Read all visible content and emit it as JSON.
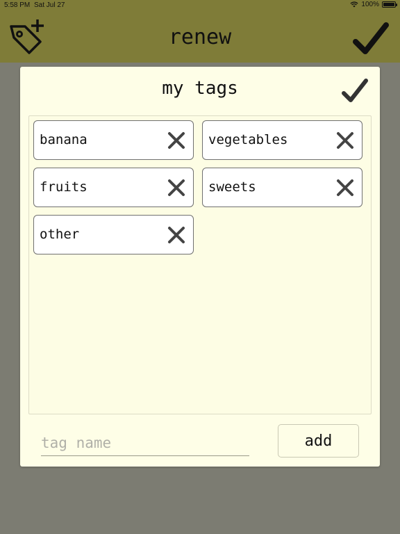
{
  "status_bar": {
    "time": "5:58 PM",
    "date": "Sat Jul 27",
    "battery": "100%",
    "battery_level": 1.0
  },
  "nav": {
    "title": "renew",
    "left_icon": "tag-plus-icon",
    "right_icon": "checkmark-icon",
    "bar_color": "#7f7c38"
  },
  "dialog": {
    "title": "my tags",
    "confirm_icon": "checkmark-icon",
    "background": "#fefee7",
    "tags": [
      {
        "label": "banana"
      },
      {
        "label": "vegetables"
      },
      {
        "label": "fruits"
      },
      {
        "label": "sweets"
      },
      {
        "label": "other"
      }
    ],
    "remove_icon": "close-x-icon",
    "input": {
      "placeholder": "tag name",
      "value": ""
    },
    "add_label": "add"
  }
}
